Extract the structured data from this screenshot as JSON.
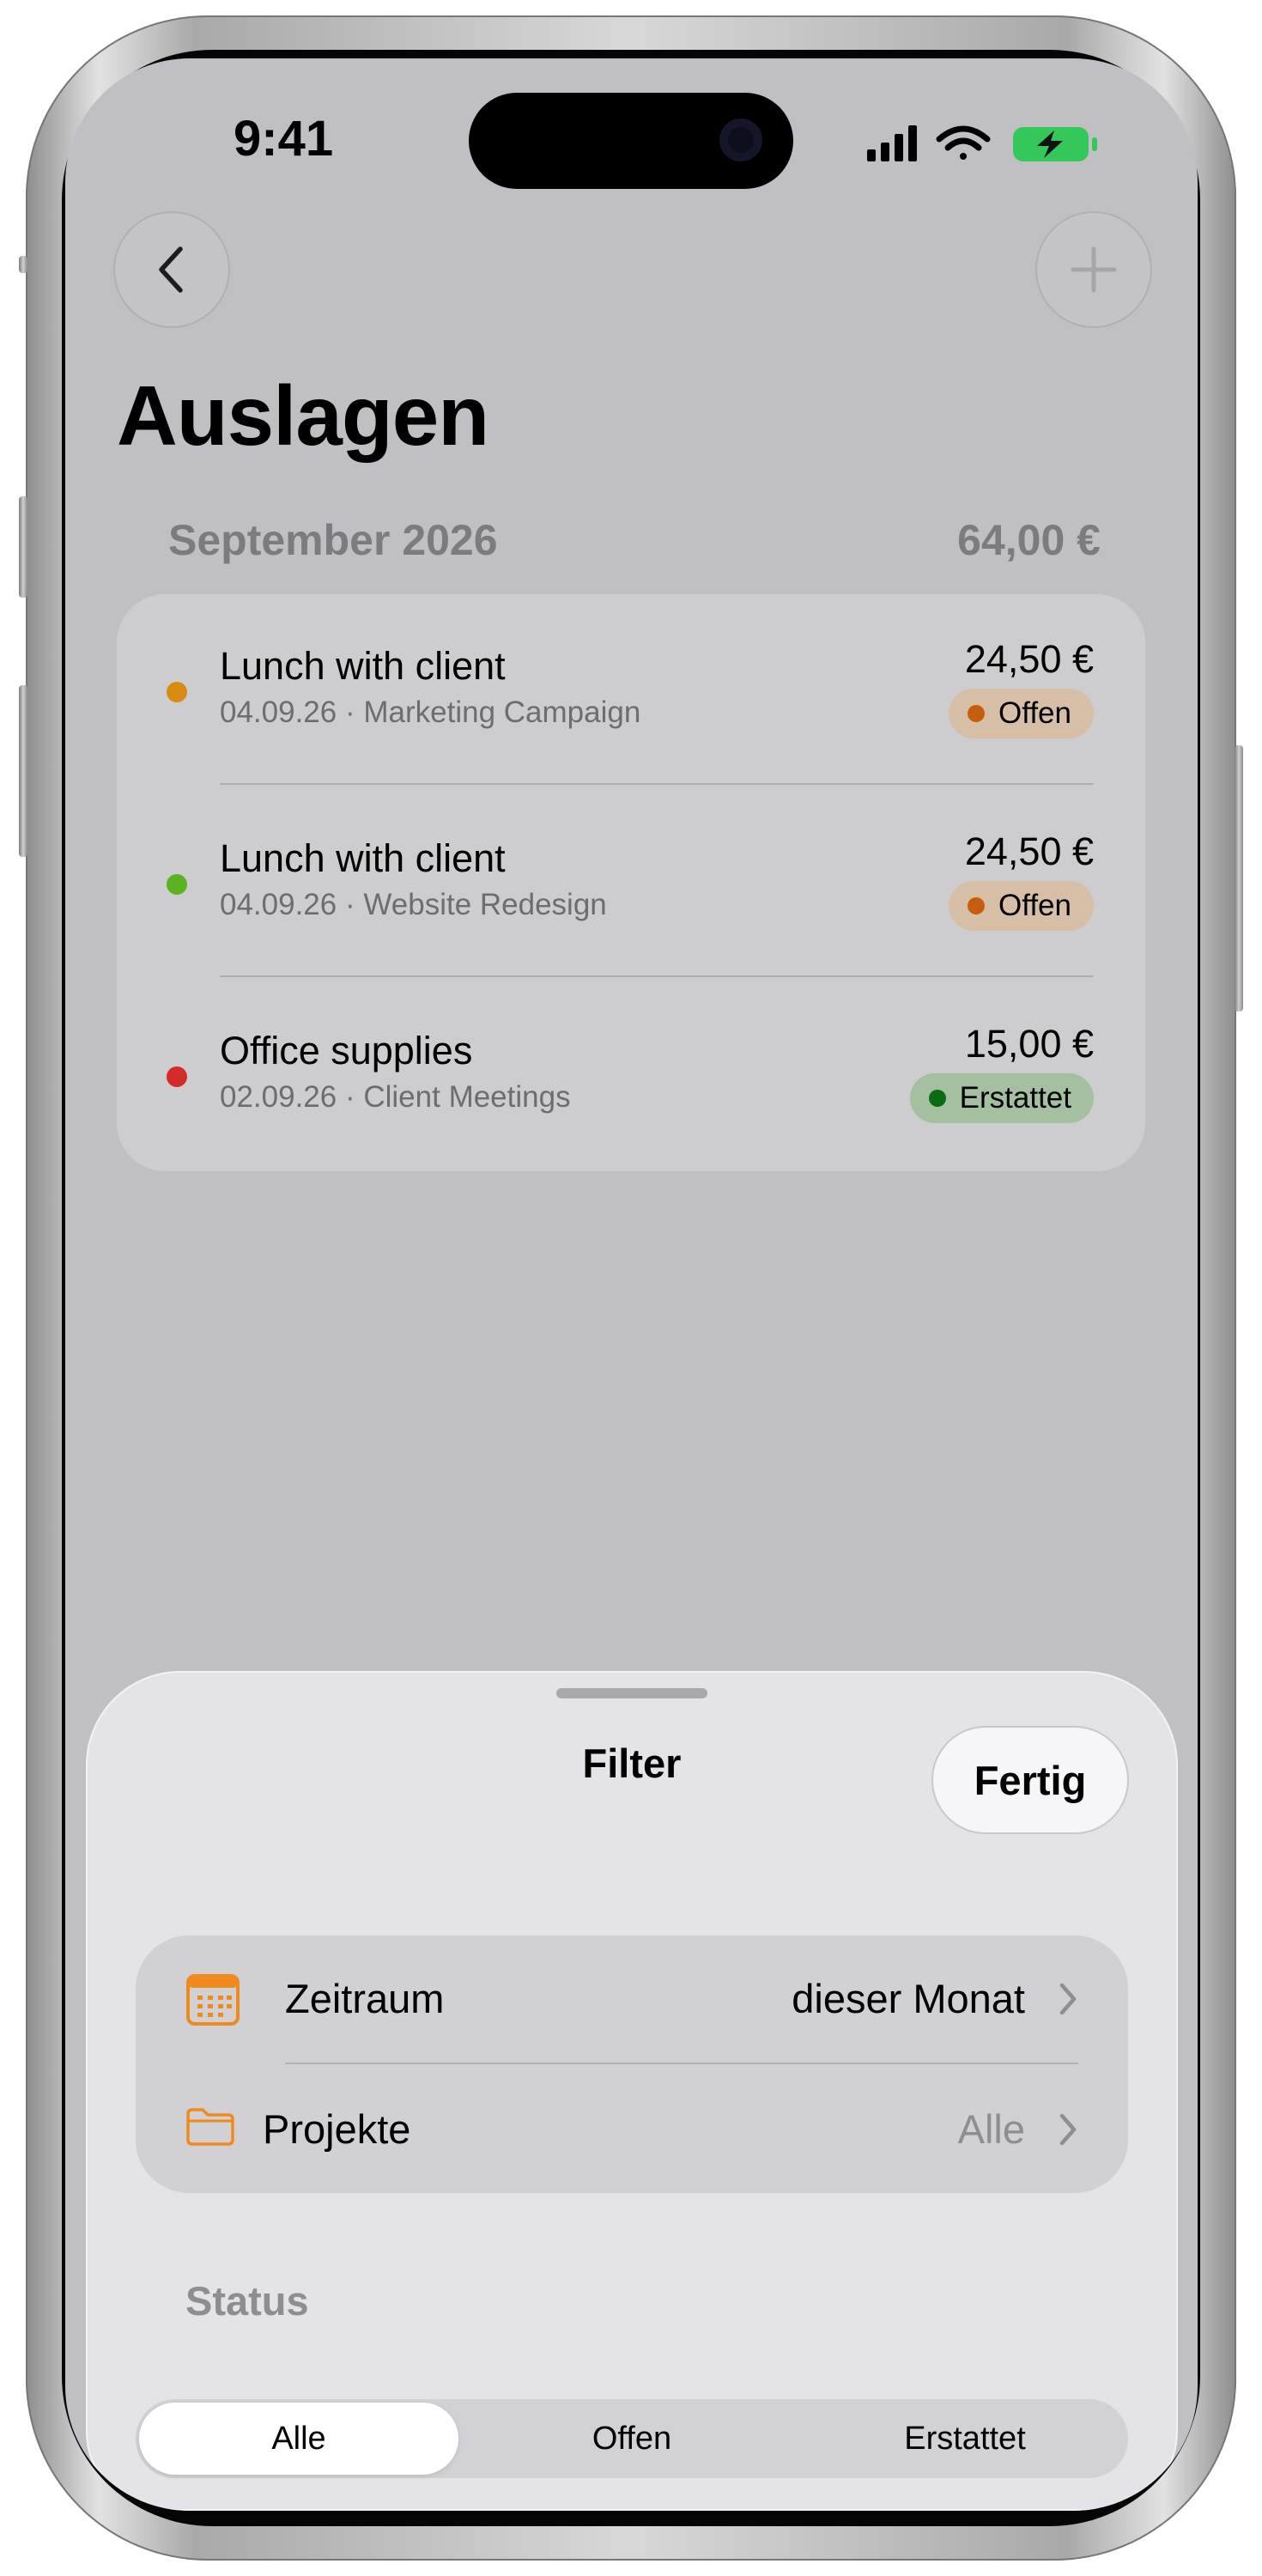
{
  "status_bar": {
    "time": "9:41"
  },
  "nav": {
    "back_icon": "chevron-left-icon",
    "add_icon": "plus-icon"
  },
  "page": {
    "title": "Auslagen"
  },
  "section": {
    "month": "September 2026",
    "total": "64,00 €"
  },
  "expenses": [
    {
      "name": "Lunch with client",
      "date": "04.09.26",
      "project": "Marketing Campaign",
      "amount": "24,50 €",
      "status": "Offen",
      "dot_color": "#d88b10"
    },
    {
      "name": "Lunch with client",
      "date": "04.09.26",
      "project": "Website Redesign",
      "amount": "24,50 €",
      "status": "Offen",
      "dot_color": "#5bb320"
    },
    {
      "name": "Office supplies",
      "date": "02.09.26",
      "project": "Client Meetings",
      "amount": "15,00 €",
      "status": "Erstattet",
      "dot_color": "#d22b28"
    }
  ],
  "meta_separator": " · ",
  "sheet": {
    "title": "Filter",
    "done_label": "Fertig",
    "rows": [
      {
        "icon": "calendar-icon",
        "label": "Zeitraum",
        "value": "dieser Monat"
      },
      {
        "icon": "folder-icon",
        "label": "Projekte",
        "value": "Alle"
      }
    ],
    "status_label": "Status",
    "segments": [
      "Alle",
      "Offen",
      "Erstattet"
    ],
    "selected_segment": "Alle"
  },
  "colors": {
    "accent_orange": "#f08a1a",
    "open_badge_bg": "#d6bfa6",
    "paid_badge_bg": "#a5bfa1"
  }
}
